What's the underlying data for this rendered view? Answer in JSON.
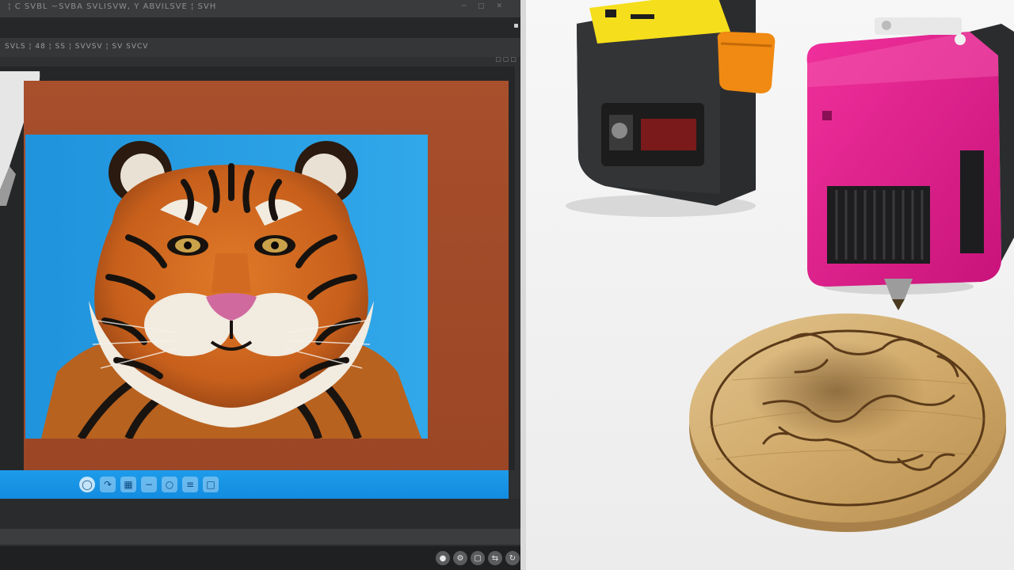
{
  "editor": {
    "title_bar_text": " ¦ C SVBL  ~SVBA SVLISVW, Y ABVILSVE ¦ SVH",
    "options_bar_text": "SVLS ¦ 48  ¦ SS  ¦ SVVSV  ¦ SV  SVCV",
    "status_icons": [
      "globe-icon",
      "cursor-icon",
      "grid-icon",
      "minus-icon",
      "zoom-icon",
      "layers-icon",
      "info-icon"
    ],
    "tray_icons": [
      "droplet-icon",
      "gear-icon",
      "monitor-icon",
      "sync-icon",
      "refresh-icon"
    ]
  },
  "colors": {
    "canvas_background": "#a84f2c",
    "photo_sky": "#29a0e3",
    "status_bar": "#1e9bea",
    "editor_chrome": "#2f3031",
    "engraver_body": "#e01f8c",
    "laser_module": "#2a2a2a",
    "label_yellow": "#f7e11f",
    "knob_orange": "#f08a12",
    "wood_disc": "#cfae78"
  }
}
